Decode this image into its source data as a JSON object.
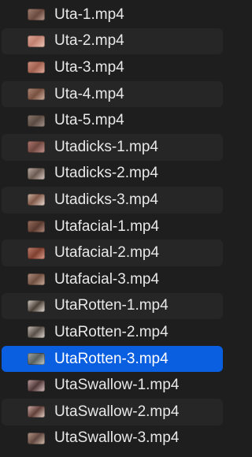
{
  "files": [
    {
      "name": "Uta-1.mp4"
    },
    {
      "name": "Uta-2.mp4"
    },
    {
      "name": "Uta-3.mp4"
    },
    {
      "name": "Uta-4.mp4"
    },
    {
      "name": "Uta-5.mp4"
    },
    {
      "name": "Utadicks-1.mp4"
    },
    {
      "name": "Utadicks-2.mp4"
    },
    {
      "name": "Utadicks-3.mp4"
    },
    {
      "name": "Utafacial-1.mp4"
    },
    {
      "name": "Utafacial-2.mp4"
    },
    {
      "name": "Utafacial-3.mp4"
    },
    {
      "name": "UtaRotten-1.mp4"
    },
    {
      "name": "UtaRotten-2.mp4"
    },
    {
      "name": "UtaRotten-3.mp4"
    },
    {
      "name": "UtaSwallow-1.mp4"
    },
    {
      "name": "UtaSwallow-2.mp4"
    },
    {
      "name": "UtaSwallow-3.mp4"
    }
  ],
  "selected_file": "UtaRotten-3.mp4",
  "colors": {
    "background": "#1e1e1e",
    "alternate_row": "#262626",
    "selection": "#0a5ee0",
    "text": "#e8e8e8"
  }
}
